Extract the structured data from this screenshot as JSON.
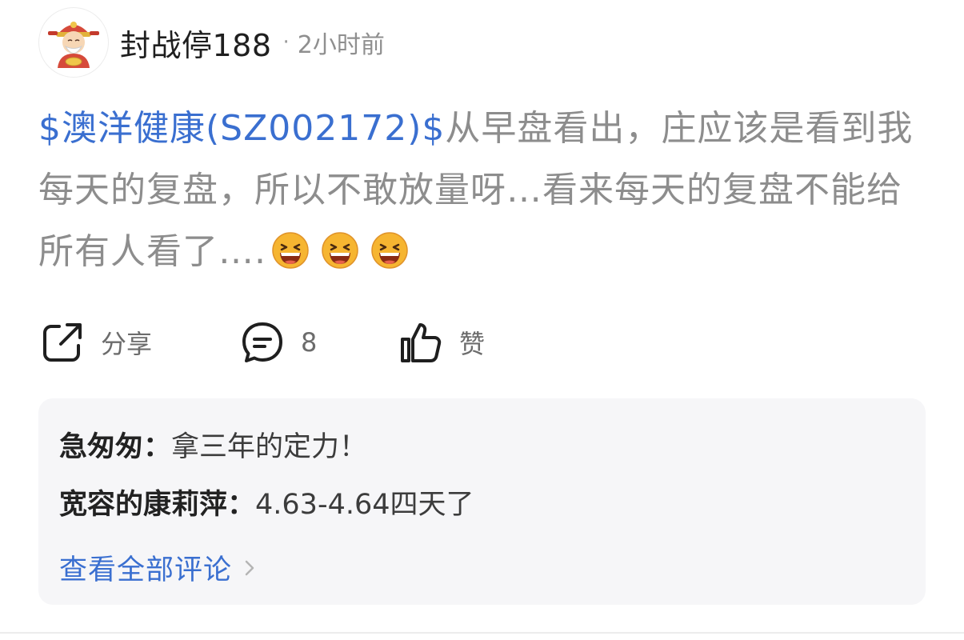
{
  "post": {
    "author": {
      "name": "封战停188",
      "avatar_icon": "fortune-god-avatar"
    },
    "separator": "·",
    "timestamp": "2小时前",
    "stock_tag": "$澳洋健康(SZ002172)$",
    "content": "从早盘看出，庄应该是看到我每天的复盘，所以不敢放量呀…看来每天的复盘不能给所有人看了….",
    "emojis": [
      "grinning-face-icon",
      "grinning-face-icon",
      "grinning-face-icon"
    ]
  },
  "actions": {
    "share_label": "分享",
    "comment_count": "8",
    "like_label": "赞"
  },
  "comments": {
    "items": [
      {
        "author": "急匆匆：",
        "text": "拿三年的定力！"
      },
      {
        "author": "宽容的康莉萍：",
        "text": "4.63-4.64四天了"
      }
    ],
    "view_all_label": "查看全部评论"
  },
  "colors": {
    "link": "#3a6fd0",
    "body_text": "#8d8d8d",
    "comment_bg": "#f6f6f8"
  }
}
